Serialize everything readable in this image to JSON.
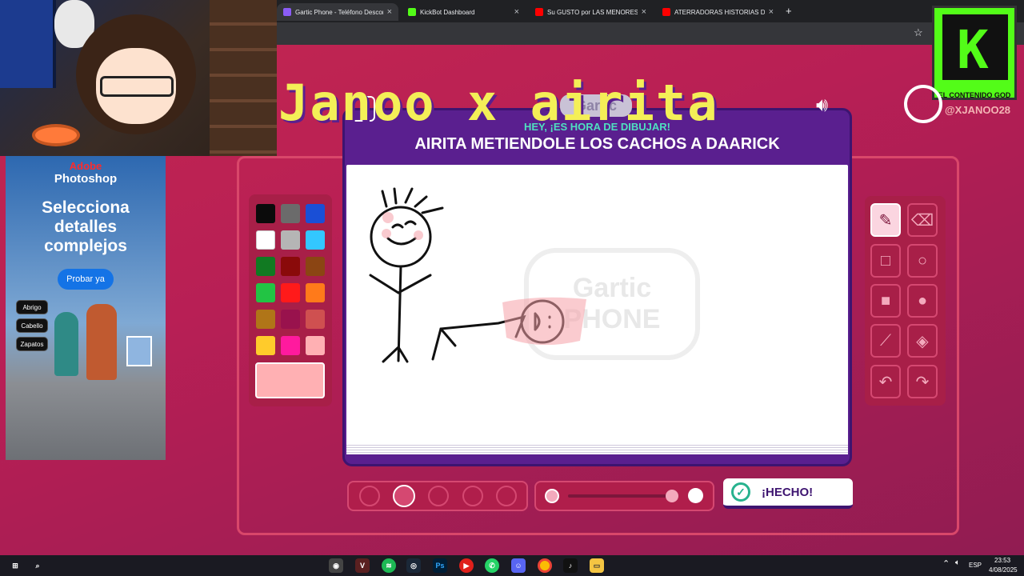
{
  "browser": {
    "tabs": [
      {
        "label": "Gartic Phone - Teléfono Descon",
        "active": true
      },
      {
        "label": "KickBot Dashboard",
        "active": false
      },
      {
        "label": "Su GUSTO por LAS MENORES p",
        "active": false
      },
      {
        "label": "ATERRADORAS HISTORIAS DE",
        "active": false
      }
    ],
    "new_tab": "+",
    "bookmark_icon": "star-icon"
  },
  "overlay": {
    "title": "Janoo x airita"
  },
  "game": {
    "logo": "Gartic",
    "subtitle": "HEY, ¡ES HORA DE DIBUJAR!",
    "prompt": "AIRITA METIENDOLE LOS CACHOS A DAARICK",
    "watermark_top": "Gartic",
    "watermark_bottom": "PHONE",
    "done_button": "¡HECHO!",
    "palette": [
      "#0b0b0b",
      "#6b6b6b",
      "#1a4fd6",
      "#ffffff",
      "#b5b5b5",
      "#33c7ff",
      "#117a22",
      "#8a0a0a",
      "#8b4513",
      "#22c444",
      "#ff1a1a",
      "#ff7a1a",
      "#b07518",
      "#99124d",
      "#cf5050",
      "#ffcb2b",
      "#ff1a9e",
      "#ffb0b3"
    ],
    "current_color": "#ffb0b3",
    "opacity_level": 0.95
  },
  "ad": {
    "brand": "Adobe",
    "product": "Photoshop",
    "headline": "Selecciona detalles complejos",
    "cta": "Probar ya",
    "chips": [
      "Abrigo",
      "Cabello",
      "Zapatos"
    ]
  },
  "stream": {
    "kick_label": "EL CONTENIDO GOD",
    "handle": "@XJANOO28"
  },
  "taskbar": {
    "language": "ESP",
    "time": "23:53",
    "date": "4/08/2025"
  }
}
